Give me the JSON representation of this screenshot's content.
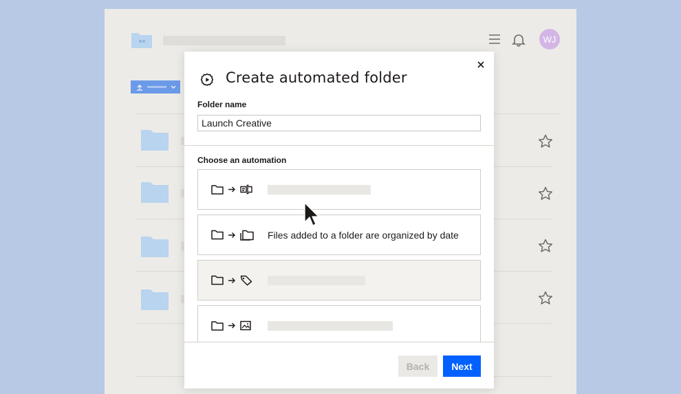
{
  "header": {
    "avatar_initials": "WJ"
  },
  "modal": {
    "title": "Create automated folder",
    "folder_name_label": "Folder name",
    "folder_name_value": "Launch Creative",
    "choose_label": "Choose an automation",
    "options": [
      {
        "icon": "rename-icon",
        "text": ""
      },
      {
        "icon": "folders-icon",
        "text": "Files added to a folder are organized by date"
      },
      {
        "icon": "tag-icon",
        "text": ""
      },
      {
        "icon": "image-icon",
        "text": ""
      }
    ],
    "back_label": "Back",
    "next_label": "Next"
  },
  "colors": {
    "accent": "#0061fe",
    "background": "#b7c9e4",
    "folder": "#b8d4ee",
    "avatar": "#d3b6e6"
  }
}
